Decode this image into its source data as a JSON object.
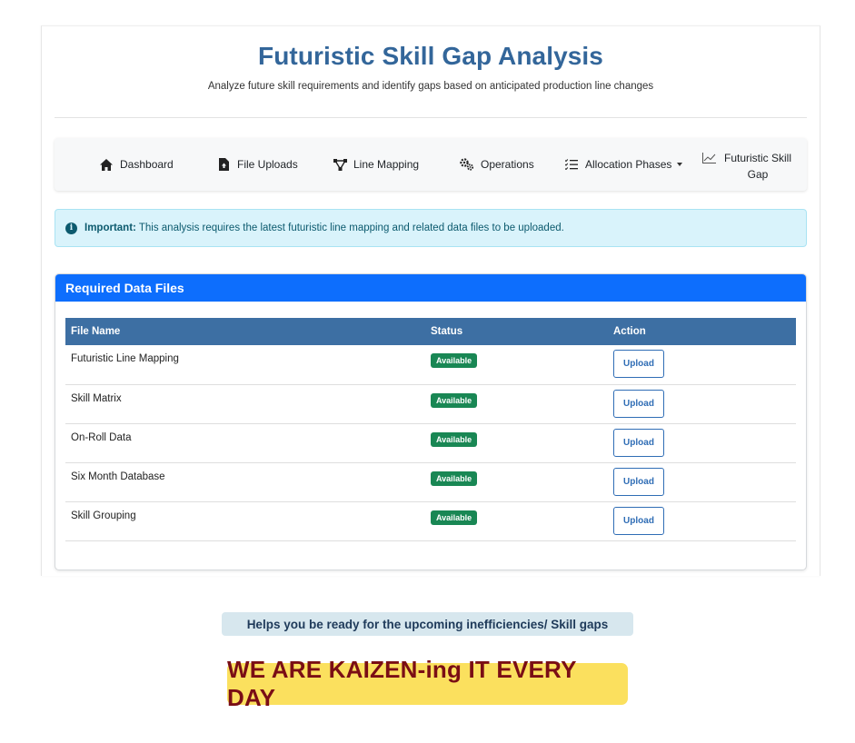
{
  "header": {
    "title": "Futuristic Skill Gap Analysis",
    "subtitle": "Analyze future skill requirements and identify gaps based on anticipated production line changes"
  },
  "nav": {
    "items": [
      {
        "label": "Dashboard",
        "icon": "home-icon"
      },
      {
        "label": "File Uploads",
        "icon": "file-upload-icon"
      },
      {
        "label": "Line Mapping",
        "icon": "line-mapping-icon"
      },
      {
        "label": "Operations",
        "icon": "gears-icon"
      },
      {
        "label": "Allocation Phases",
        "icon": "list-check-icon"
      },
      {
        "label": "Futuristic Skill Gap",
        "icon": "line-chart-icon"
      }
    ]
  },
  "alert": {
    "strong": "Important:",
    "text": "This analysis requires the latest futuristic line mapping and related data files to be uploaded."
  },
  "panel": {
    "title": "Required Data Files",
    "columns": [
      "File Name",
      "Status",
      "Action"
    ],
    "rows": [
      {
        "name": "Futuristic Line Mapping",
        "status": "Available",
        "action": "Upload"
      },
      {
        "name": "Skill Matrix",
        "status": "Available",
        "action": "Upload"
      },
      {
        "name": "On-Roll Data",
        "status": "Available",
        "action": "Upload"
      },
      {
        "name": "Six Month Database",
        "status": "Available",
        "action": "Upload"
      },
      {
        "name": "Skill Grouping",
        "status": "Available",
        "action": "Upload"
      }
    ]
  },
  "footer": {
    "tagline": "Helps you be ready for the upcoming inefficiencies/ Skill gaps",
    "slogan": "WE ARE KAIZEN-ing IT EVERY DAY"
  },
  "colors": {
    "title": "#33669a",
    "panel_header": "#0d6efd",
    "table_header": "#3d6fa3",
    "badge": "#198754",
    "alert_bg": "#d9f3fb",
    "slogan_bg": "#fbe05e",
    "slogan_text": "#7a0e15"
  }
}
